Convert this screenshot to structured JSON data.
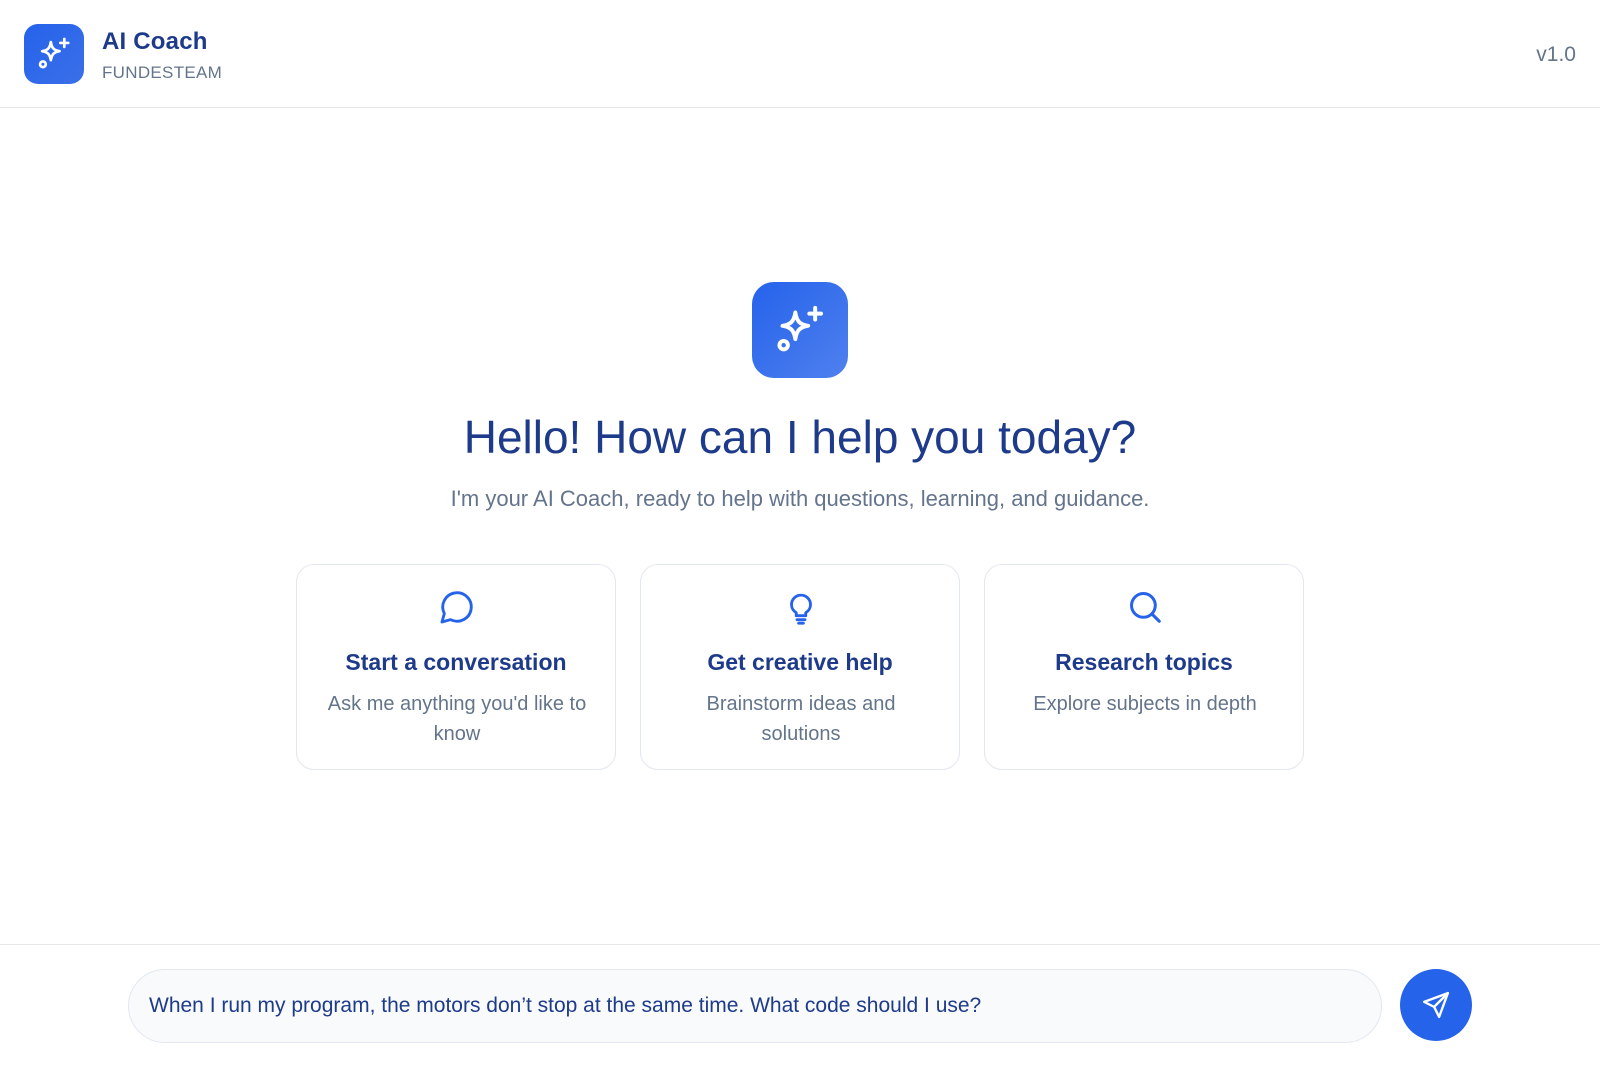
{
  "header": {
    "title": "AI Coach",
    "subtitle": "FUNDESTEAM",
    "version": "v1.0",
    "logo_icon": "sparkles-icon"
  },
  "hero": {
    "icon": "sparkles-icon",
    "title": "Hello! How can I help you today?",
    "subtitle": "I'm your AI Coach, ready to help with questions, learning, and guidance."
  },
  "cards": [
    {
      "icon": "chat-bubble-icon",
      "title": "Start a conversation",
      "description": "Ask me anything you'd like to know"
    },
    {
      "icon": "lightbulb-icon",
      "title": "Get creative help",
      "description": "Brainstorm ideas and solutions"
    },
    {
      "icon": "search-icon",
      "title": "Research topics",
      "description": "Explore subjects in depth"
    }
  ],
  "composer": {
    "value": "When I run my program, the motors don’t stop at the same time. What code should I use?",
    "send_icon": "send-icon"
  },
  "colors": {
    "accent": "#2563eb",
    "heading": "#1e3a8a",
    "muted": "#64748b",
    "border": "#e2e8f0",
    "background": "#f8fafc"
  }
}
